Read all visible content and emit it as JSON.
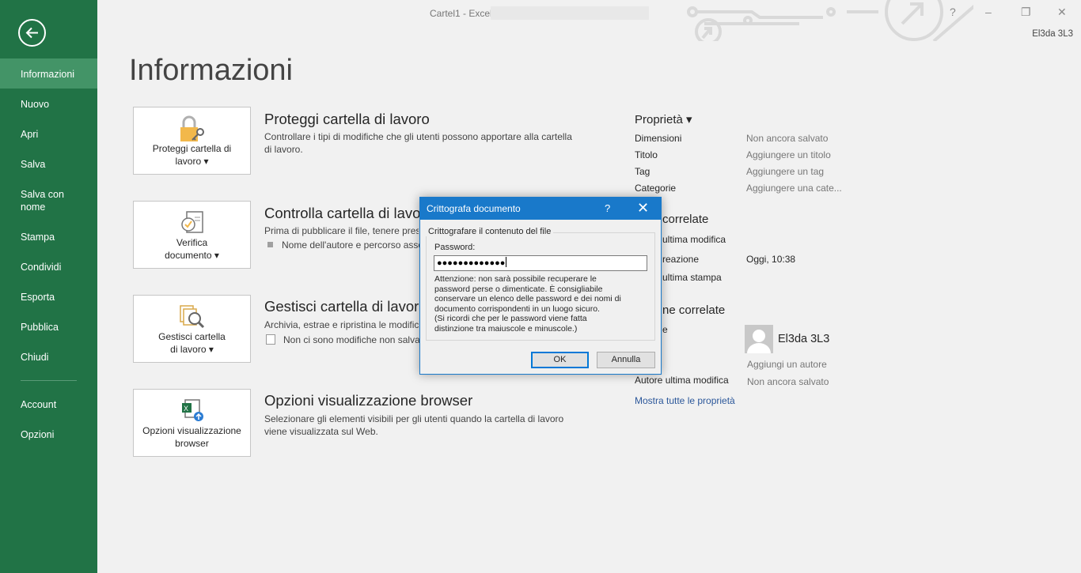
{
  "window": {
    "title": "Cartel1 - Excel",
    "user": "El3da 3L3",
    "controls": {
      "help": "?",
      "minimize": "–",
      "restore": "❐",
      "close": "✕"
    }
  },
  "sidebar": {
    "back_icon": "arrow-left-icon",
    "items": [
      {
        "label": "Informazioni",
        "active": true
      },
      {
        "label": "Nuovo"
      },
      {
        "label": "Apri"
      },
      {
        "label": "Salva"
      },
      {
        "label": "Salva con nome"
      },
      {
        "label": "Stampa"
      },
      {
        "label": "Condividi"
      },
      {
        "label": "Esporta"
      },
      {
        "label": "Pubblica"
      },
      {
        "label": "Chiudi"
      },
      {
        "label": "Account"
      },
      {
        "label": "Opzioni"
      }
    ]
  },
  "main": {
    "title": "Informazioni",
    "sections": [
      {
        "card_label": "Proteggi cartella di lavoro ▾",
        "card_icon": "lock-key-icon",
        "title": "Proteggi cartella di lavoro",
        "description": "Controllare i tipi di modifiche che gli utenti possono apportare alla cartella di lavoro."
      },
      {
        "card_label": "Verifica documento ▾",
        "card_icon": "inspect-document-icon",
        "title": "Controlla cartella di lavoro",
        "description": "Prima di pubblicare il file, tenere pres",
        "bullet": "Nome dell'autore e percorso asso"
      },
      {
        "card_label": "Gestisci cartella di lavoro ▾",
        "card_icon": "manage-workbook-icon",
        "title": "Gestisci cartella di lavoro",
        "description": "Archivia, estrae e ripristina le modifich",
        "bullet": "Non ci sono modifiche non salva"
      },
      {
        "card_label": "Opzioni visualizzazione browser",
        "card_icon": "excel-browser-icon",
        "title": "Opzioni visualizzazione browser",
        "description": "Selezionare gli elementi visibili per gli utenti quando la cartella di lavoro viene visualizzata sul Web."
      }
    ]
  },
  "properties": {
    "header": "Proprietà ▾",
    "rows": [
      {
        "label": "Dimensioni",
        "value": "Non ancora salvato"
      },
      {
        "label": "Titolo",
        "value": "Aggiungere un titolo"
      },
      {
        "label": "Tag",
        "value": "Aggiungere un tag"
      },
      {
        "label": "Categorie",
        "value": "Aggiungere una cate..."
      }
    ],
    "dates_header": "correlate",
    "dates": [
      {
        "label": "ultima modifica",
        "value": ""
      },
      {
        "label": "reazione",
        "value": "Oggi, 10:38"
      },
      {
        "label": "ultima stampa",
        "value": ""
      }
    ],
    "people_header": "ne correlate",
    "people_label": "e",
    "author": "El3da 3L3",
    "add_author": "Aggiungi un autore",
    "last_modified_by_label": "Autore ultima modifica",
    "last_modified_by_value": "Non ancora salvato",
    "show_all_link": "Mostra tutte le proprietà"
  },
  "dialog": {
    "title": "Crittografa documento",
    "help": "?",
    "close": "✕",
    "group_title": "Crittografare il contenuto del file",
    "password_label": "Password:",
    "password_value": "●●●●●●●●●●●●●",
    "warning": "Attenzione: non sarà possibile recuperare le\npassword perse o dimenticate. È consigliabile\nconservare un elenco delle password e dei nomi di\ndocumento corrispondenti in un luogo sicuro.\n(Si ricordi che per le password viene fatta\ndistinzione tra maiuscole e minuscole.)",
    "ok_label": "OK",
    "cancel_label": "Annulla"
  },
  "colors": {
    "sidebar": "#217346",
    "sidebar_active": "#439467",
    "dialog_titlebar": "#1979ca",
    "link": "#2b579a"
  }
}
